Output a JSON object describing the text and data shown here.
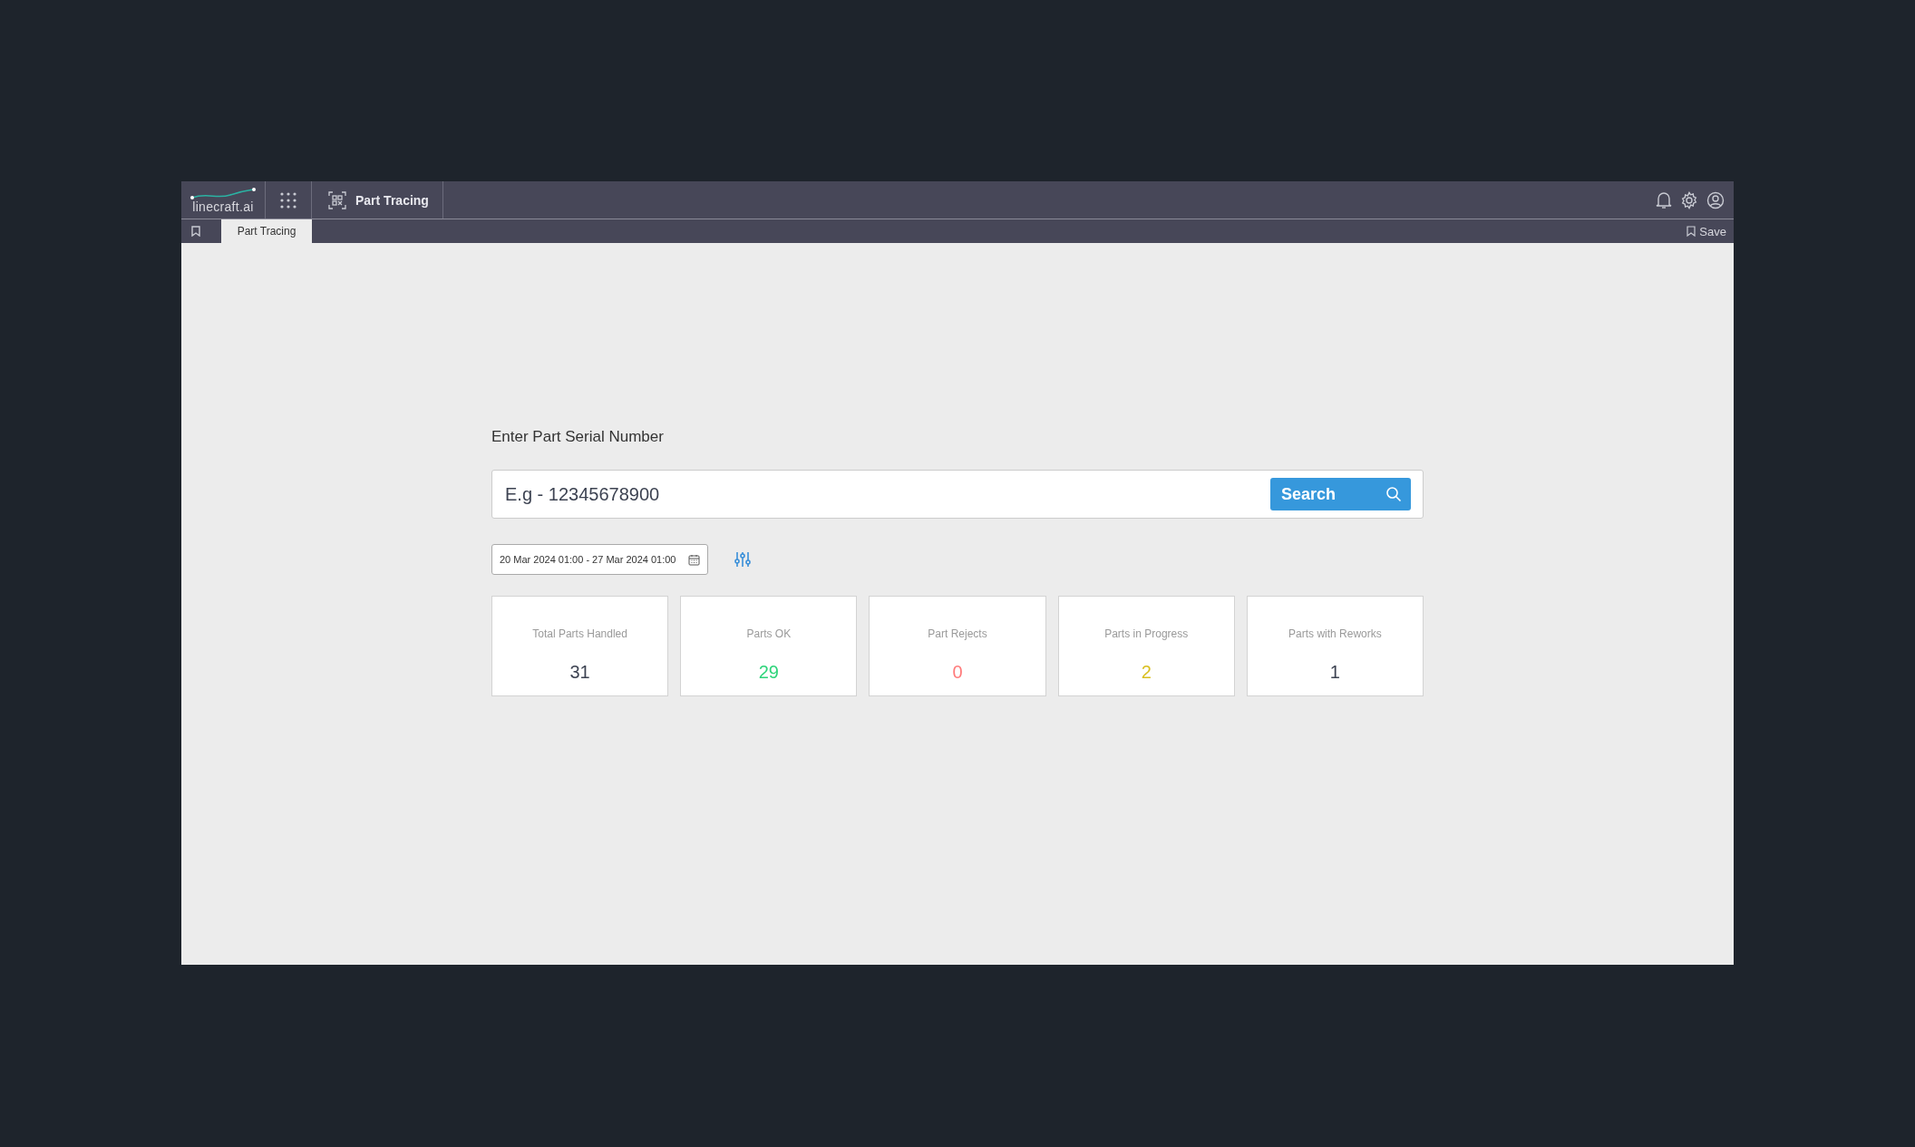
{
  "header": {
    "logo": "linecraft.ai",
    "app_title": "Part Tracing"
  },
  "tabs": [
    {
      "label": "Part Tracing",
      "selected": true
    }
  ],
  "save_label": "Save",
  "search": {
    "label": "Enter Part Serial Number",
    "placeholder": "E.g - 12345678900",
    "button": "Search"
  },
  "date_range": "20 Mar 2024 01:00 - 27 Mar 2024 01:00",
  "stats": [
    {
      "label": "Total Parts Handled",
      "value": "31",
      "color": "#3d4352"
    },
    {
      "label": "Parts OK",
      "value": "29",
      "color": "#2ed47a"
    },
    {
      "label": "Part Rejects",
      "value": "0",
      "color": "#ff7a7a"
    },
    {
      "label": "Parts in Progress",
      "value": "2",
      "color": "#d9bf1f"
    },
    {
      "label": "Parts with Reworks",
      "value": "1",
      "color": "#3d4352"
    }
  ]
}
